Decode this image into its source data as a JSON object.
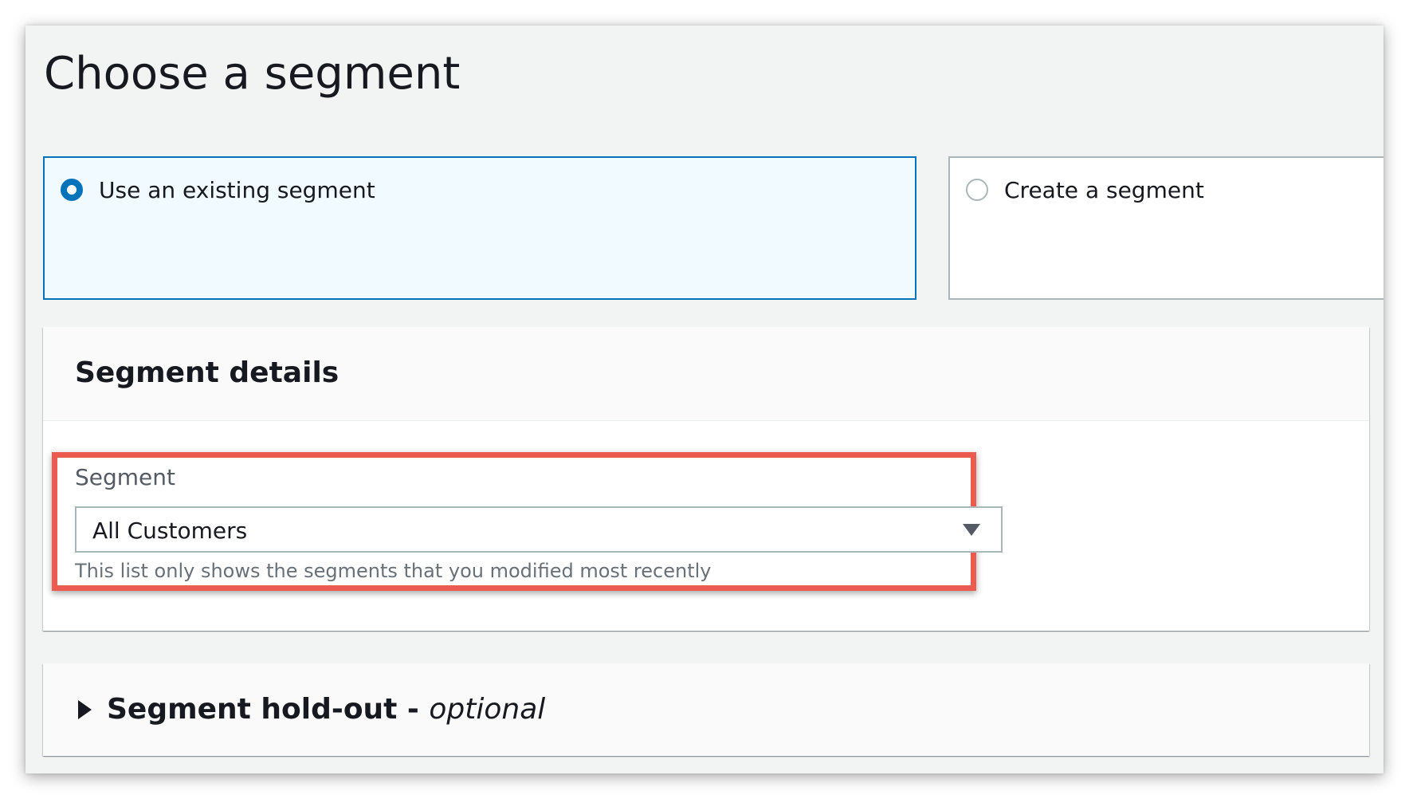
{
  "page": {
    "title": "Choose a segment"
  },
  "segment_choice": {
    "options": [
      {
        "label": "Use an existing segment",
        "selected": true
      },
      {
        "label": "Create a segment",
        "selected": false
      }
    ]
  },
  "segment_details": {
    "title": "Segment details",
    "field": {
      "label": "Segment",
      "value": "All Customers",
      "hint": "This list only shows the segments that you modified most recently"
    }
  },
  "holdout": {
    "title": "Segment hold-out - ",
    "optional_label": "optional",
    "expanded": false
  },
  "colors": {
    "accent": "#0073bb",
    "highlight": "#ec5b4f",
    "selected_tile_bg": "#f1faff"
  },
  "icons": {
    "dropdown": "caret-down-icon",
    "expand": "caret-right-icon"
  }
}
